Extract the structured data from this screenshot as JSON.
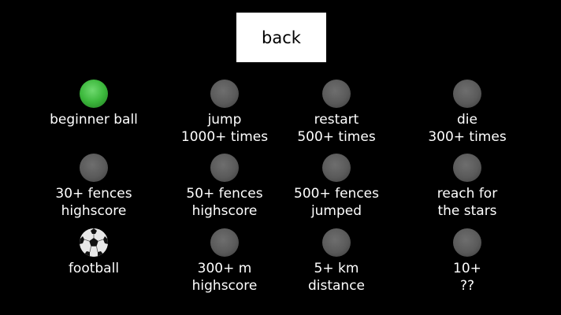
{
  "back_label": "back",
  "achievements": [
    {
      "id": "beginner-ball",
      "lines": [
        "beginner ball",
        ""
      ],
      "state": "unlocked-green"
    },
    {
      "id": "jump",
      "lines": [
        "jump",
        "1000+ times"
      ],
      "state": "locked"
    },
    {
      "id": "restart",
      "lines": [
        "restart",
        "500+ times"
      ],
      "state": "locked"
    },
    {
      "id": "die",
      "lines": [
        "die",
        "300+ times"
      ],
      "state": "locked"
    },
    {
      "id": "30-fences",
      "lines": [
        "30+ fences",
        "highscore"
      ],
      "state": "locked"
    },
    {
      "id": "50-fences",
      "lines": [
        "50+ fences",
        "highscore"
      ],
      "state": "locked"
    },
    {
      "id": "500-fences",
      "lines": [
        "500+ fences",
        "jumped"
      ],
      "state": "locked"
    },
    {
      "id": "reach-stars",
      "lines": [
        "reach for",
        "the stars"
      ],
      "state": "locked"
    },
    {
      "id": "football",
      "lines": [
        "football",
        ""
      ],
      "state": "unlocked-football"
    },
    {
      "id": "300m",
      "lines": [
        "300+ m",
        "highscore"
      ],
      "state": "locked"
    },
    {
      "id": "5km",
      "lines": [
        "5+ km",
        "distance"
      ],
      "state": "locked"
    },
    {
      "id": "10plus",
      "lines": [
        "10+",
        "??"
      ],
      "state": "locked"
    }
  ],
  "colors": {
    "background": "#000000",
    "text": "#ffffff",
    "locked_ball": "#5a5a5a",
    "beginner_ball": "#3cb83c",
    "back_button_bg": "#ffffff"
  }
}
